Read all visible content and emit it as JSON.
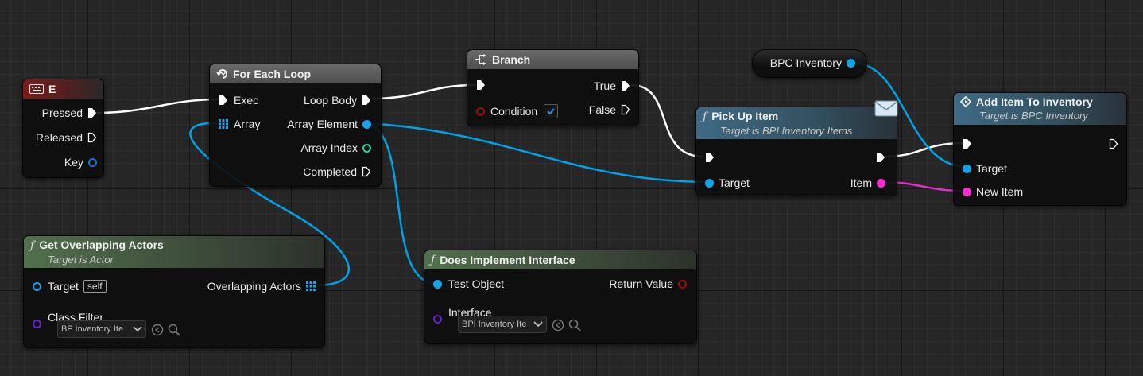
{
  "nodes": {
    "e_key": {
      "title": "E",
      "pressed": "Pressed",
      "released": "Released",
      "key": "Key"
    },
    "for_each": {
      "title": "For Each Loop",
      "exec": "Exec",
      "array": "Array",
      "loop_body": "Loop Body",
      "array_element": "Array Element",
      "array_index": "Array Index",
      "completed": "Completed"
    },
    "branch": {
      "title": "Branch",
      "condition": "Condition",
      "true_label": "True",
      "false_label": "False",
      "condition_checked": true
    },
    "bpc_inventory": {
      "label": "BPC Inventory"
    },
    "pick_up_item": {
      "title": "Pick Up Item",
      "subtitle": "Target is BPI Inventory Items",
      "target": "Target",
      "item": "Item"
    },
    "add_item": {
      "title": "Add Item To Inventory",
      "subtitle": "Target is BPC Inventory",
      "target": "Target",
      "new_item": "New Item"
    },
    "get_overlapping": {
      "title": "Get Overlapping Actors",
      "subtitle": "Target is Actor",
      "target": "Target",
      "self_label": "self",
      "overlapping_actors": "Overlapping Actors",
      "class_filter": "Class Filter",
      "class_value": "BP Inventory Ite"
    },
    "does_implement": {
      "title": "Does Implement Interface",
      "test_object": "Test Object",
      "return_value": "Return Value",
      "interface": "Interface",
      "interface_value": "BPI Inventory Ite"
    }
  },
  "colors": {
    "exec": "#ffffff",
    "object": "#00a8f0",
    "struct_item": "#ff2bd2",
    "int": "#1ed4a0",
    "bool": "#9b0d0d",
    "class": "#6a1fd0"
  },
  "icons": [
    "keyboard-icon",
    "loop-icon",
    "branch-icon",
    "function-icon",
    "message-icon",
    "interface-call-icon",
    "array-grid-icon",
    "checkmark-icon",
    "chevron-down-icon",
    "browse-arrow-icon",
    "search-icon"
  ]
}
